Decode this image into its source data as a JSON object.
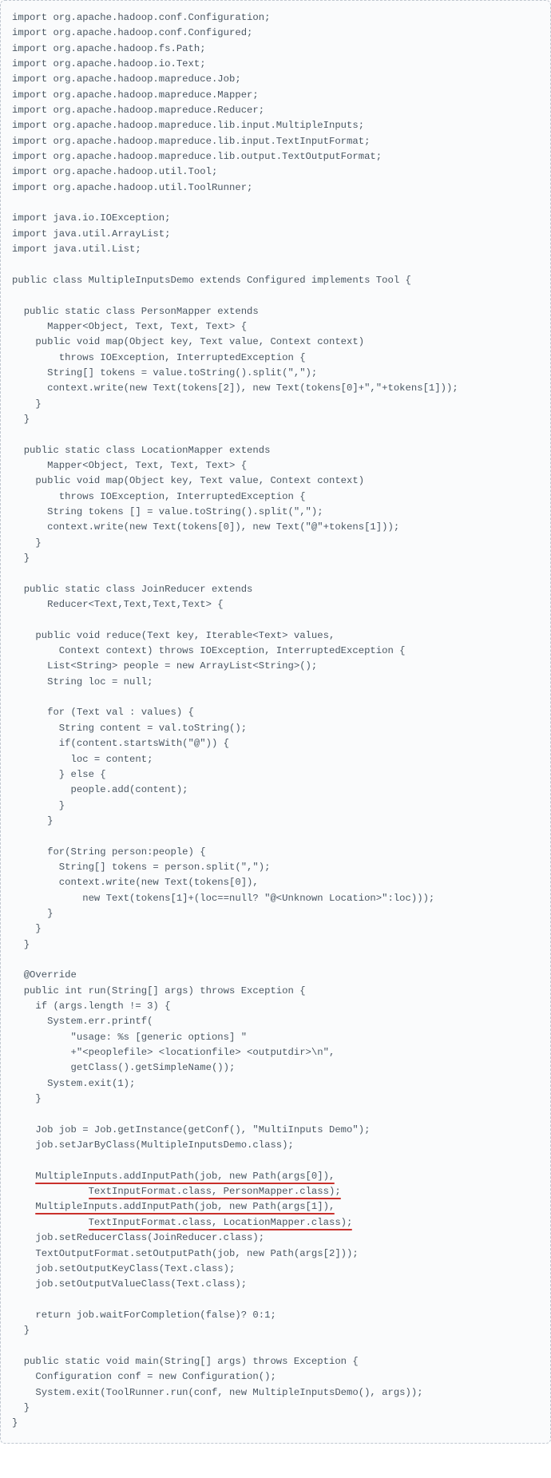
{
  "code_lines": [
    "import org.apache.hadoop.conf.Configuration;",
    "import org.apache.hadoop.conf.Configured;",
    "import org.apache.hadoop.fs.Path;",
    "import org.apache.hadoop.io.Text;",
    "import org.apache.hadoop.mapreduce.Job;",
    "import org.apache.hadoop.mapreduce.Mapper;",
    "import org.apache.hadoop.mapreduce.Reducer;",
    "import org.apache.hadoop.mapreduce.lib.input.MultipleInputs;",
    "import org.apache.hadoop.mapreduce.lib.input.TextInputFormat;",
    "import org.apache.hadoop.mapreduce.lib.output.TextOutputFormat;",
    "import org.apache.hadoop.util.Tool;",
    "import org.apache.hadoop.util.ToolRunner;",
    "",
    "import java.io.IOException;",
    "import java.util.ArrayList;",
    "import java.util.List;",
    "",
    "public class MultipleInputsDemo extends Configured implements Tool {",
    "",
    "  public static class PersonMapper extends",
    "      Mapper<Object, Text, Text, Text> {",
    "    public void map(Object key, Text value, Context context)",
    "        throws IOException, InterruptedException {",
    "      String[] tokens = value.toString().split(\",\");",
    "      context.write(new Text(tokens[2]), new Text(tokens[0]+\",\"+tokens[1]));",
    "    }",
    "  }",
    "",
    "  public static class LocationMapper extends",
    "      Mapper<Object, Text, Text, Text> {",
    "    public void map(Object key, Text value, Context context)",
    "        throws IOException, InterruptedException {",
    "      String tokens [] = value.toString().split(\",\");",
    "      context.write(new Text(tokens[0]), new Text(\"@\"+tokens[1]));",
    "    }",
    "  }",
    "",
    "  public static class JoinReducer extends",
    "      Reducer<Text,Text,Text,Text> {",
    "",
    "    public void reduce(Text key, Iterable<Text> values,",
    "        Context context) throws IOException, InterruptedException {",
    "      List<String> people = new ArrayList<String>();",
    "      String loc = null;",
    "",
    "      for (Text val : values) {",
    "        String content = val.toString();",
    "        if(content.startsWith(\"@\")) {",
    "          loc = content;",
    "        } else {",
    "          people.add(content);",
    "        }",
    "      }",
    "",
    "      for(String person:people) {",
    "        String[] tokens = person.split(\",\");",
    "        context.write(new Text(tokens[0]),",
    "            new Text(tokens[1]+(loc==null? \"@<Unknown Location>\":loc)));",
    "      }",
    "    }",
    "  }",
    "",
    "  @Override",
    "  public int run(String[] args) throws Exception {",
    "    if (args.length != 3) {",
    "      System.err.printf(",
    "          \"usage: %s [generic options] \"",
    "          +\"<peoplefile> <locationfile> <outputdir>\\n\",",
    "          getClass().getSimpleName());",
    "      System.exit(1);",
    "    }",
    "",
    "    Job job = Job.getInstance(getConf(), \"MultiInputs Demo\");",
    "    job.setJarByClass(MultipleInputsDemo.class);",
    "",
    "    MultipleInputs.addInputPath(job, new Path(args[0]),",
    "             TextInputFormat.class, PersonMapper.class);",
    "    MultipleInputs.addInputPath(job, new Path(args[1]),",
    "             TextInputFormat.class, LocationMapper.class);",
    "    job.setReducerClass(JoinReducer.class);",
    "    TextOutputFormat.setOutputPath(job, new Path(args[2]));",
    "    job.setOutputKeyClass(Text.class);",
    "    job.setOutputValueClass(Text.class);",
    "",
    "    return job.waitForCompletion(false)? 0:1;",
    "  }",
    "",
    "  public static void main(String[] args) throws Exception {",
    "    Configuration conf = new Configuration();",
    "    System.exit(ToolRunner.run(conf, new MultipleInputsDemo(), args));",
    "  }",
    "}"
  ],
  "highlighted_line_indices": [
    75,
    76,
    77,
    78
  ]
}
